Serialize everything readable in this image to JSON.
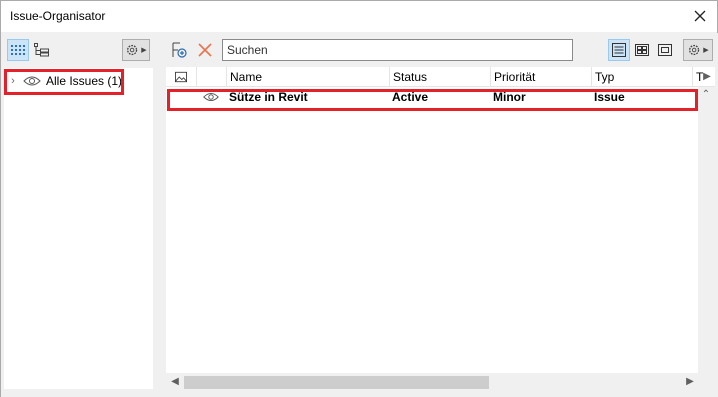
{
  "window": {
    "title": "Issue-Organisator"
  },
  "tree": {
    "items": [
      {
        "label": "Alle Issues (1)"
      }
    ]
  },
  "search": {
    "placeholder": "Suchen"
  },
  "table": {
    "columns": [
      "Name",
      "Status",
      "Priorität",
      "Typ",
      "T"
    ],
    "rows": [
      {
        "name": "Sütze in Revit",
        "status": "Active",
        "priority": "Minor",
        "type": "Issue"
      }
    ]
  },
  "colors": {
    "highlight": "#e2212a",
    "accent": "#2b6cb0",
    "delete": "#e8734e"
  },
  "icons": [
    "close-icon",
    "grid-view-icon",
    "tree-view-icon",
    "gear-icon",
    "eye-icon",
    "new-issue-icon",
    "delete-icon",
    "list-view-icon",
    "tile-view-icon",
    "single-view-icon",
    "photo-column-icon"
  ]
}
